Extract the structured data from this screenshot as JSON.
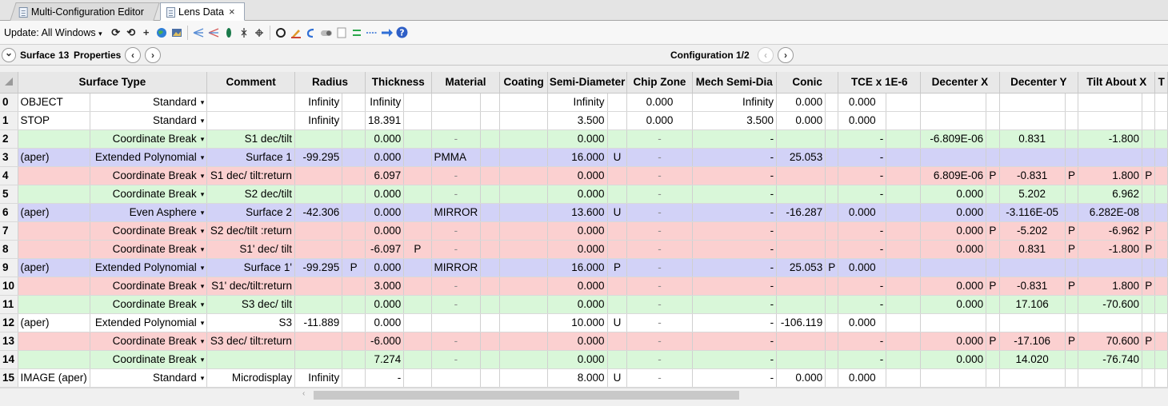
{
  "tabs": [
    {
      "label": "Multi-Configuration Editor",
      "active": false
    },
    {
      "label": "Lens Data",
      "active": true,
      "close": "×"
    }
  ],
  "toolbar": {
    "update_label": "Update: All Windows",
    "update_caret": "▾",
    "icons": [
      "refresh-icon",
      "refresh-all-icon",
      "crosshair-icon",
      "globe-icon",
      "picture-icon",
      "ray-fan-icon",
      "ray-fan-alt-icon",
      "lens-up-icon",
      "lens-down-icon",
      "lens-split-icon",
      "aperture-icon",
      "edit-pen-icon",
      "undo-icon",
      "toggle-icon",
      "document-icon",
      "arrows-icon",
      "link-icon",
      "arrow-right-icon",
      "help-icon"
    ]
  },
  "propbar": {
    "expand_glyph": "⌄",
    "surface_label": "Surface",
    "surface_number": "13",
    "properties_label": "Properties",
    "prev_glyph": "‹",
    "next_glyph": "›",
    "config_label": "Configuration 1/2"
  },
  "columns": [
    "",
    "Surface Type",
    "Comment",
    "Radius",
    "Thickness",
    "Material",
    "Coating",
    "Semi-Diameter",
    "Chip Zone",
    "Mech Semi-Dia",
    "Conic",
    "TCE x 1E-6",
    "Decenter X",
    "Decenter Y",
    "Tilt About X",
    "T"
  ],
  "rows": [
    {
      "num": "0",
      "name": "OBJECT",
      "type": "Standard",
      "comment": "",
      "radius": "Infinity",
      "radius_s": "",
      "thickness": "Infinity",
      "thickness_s": "",
      "material": "",
      "coating": "",
      "semi": "Infinity",
      "semi_s": "",
      "chip": "0.000",
      "mech": "Infinity",
      "conic": "0.000",
      "conic_s": "",
      "tce": "0.000",
      "decx": "",
      "decx_s": "",
      "decy": "",
      "decy_s": "",
      "tilt": "",
      "tilt_s": "",
      "color": "white"
    },
    {
      "num": "1",
      "name": "STOP",
      "type": "Standard",
      "comment": "",
      "radius": "Infinity",
      "radius_s": "",
      "thickness": "18.391",
      "thickness_s": "",
      "material": "",
      "coating": "",
      "semi": "3.500",
      "semi_s": "",
      "chip": "0.000",
      "mech": "3.500",
      "conic": "0.000",
      "conic_s": "",
      "tce": "0.000",
      "decx": "",
      "decx_s": "",
      "decy": "",
      "decy_s": "",
      "tilt": "",
      "tilt_s": "",
      "color": "white"
    },
    {
      "num": "2",
      "name": "",
      "type": "Coordinate Break",
      "comment": "S1 dec/tilt",
      "radius": "",
      "radius_s": "",
      "thickness": "0.000",
      "thickness_s": "",
      "material": "-",
      "coating": "",
      "semi": "0.000",
      "semi_s": "",
      "chip": "-",
      "mech": "-",
      "conic": "",
      "conic_s": "",
      "tce": "-",
      "decx": "-6.809E-06",
      "decx_s": "",
      "decy": "0.831",
      "decy_s": "",
      "tilt": "-1.800",
      "tilt_s": "",
      "color": "green"
    },
    {
      "num": "3",
      "name": "(aper)",
      "type": "Extended Polynomial",
      "comment": "Surface 1",
      "radius": "-99.295",
      "radius_s": "",
      "thickness": "0.000",
      "thickness_s": "",
      "material": "PMMA",
      "coating": "",
      "semi": "16.000",
      "semi_s": "U",
      "chip": "-",
      "mech": "-",
      "conic": "25.053",
      "conic_s": "",
      "tce": "-",
      "decx": "",
      "decx_s": "",
      "decy": "",
      "decy_s": "",
      "tilt": "",
      "tilt_s": "",
      "color": "blue"
    },
    {
      "num": "4",
      "name": "",
      "type": "Coordinate Break",
      "comment": "S1 dec/ tilt:return",
      "radius": "",
      "radius_s": "",
      "thickness": "6.097",
      "thickness_s": "",
      "material": "-",
      "coating": "",
      "semi": "0.000",
      "semi_s": "",
      "chip": "-",
      "mech": "-",
      "conic": "",
      "conic_s": "",
      "tce": "-",
      "decx": "6.809E-06",
      "decx_s": "P",
      "decy": "-0.831",
      "decy_s": "P",
      "tilt": "1.800",
      "tilt_s": "P",
      "color": "pink"
    },
    {
      "num": "5",
      "name": "",
      "type": "Coordinate Break",
      "comment": "S2 dec/tilt",
      "radius": "",
      "radius_s": "",
      "thickness": "0.000",
      "thickness_s": "",
      "material": "-",
      "coating": "",
      "semi": "0.000",
      "semi_s": "",
      "chip": "-",
      "mech": "-",
      "conic": "",
      "conic_s": "",
      "tce": "-",
      "decx": "0.000",
      "decx_s": "",
      "decy": "5.202",
      "decy_s": "",
      "tilt": "6.962",
      "tilt_s": "",
      "color": "green"
    },
    {
      "num": "6",
      "name": "(aper)",
      "type": "Even Asphere",
      "comment": "Surface 2",
      "radius": "-42.306",
      "radius_s": "",
      "thickness": "0.000",
      "thickness_s": "",
      "material": "MIRROR",
      "coating": "",
      "semi": "13.600",
      "semi_s": "U",
      "chip": "-",
      "mech": "-",
      "conic": "-16.287",
      "conic_s": "",
      "tce": "0.000",
      "decx": "0.000",
      "decx_s": "",
      "decy": "-3.116E-05",
      "decy_s": "",
      "tilt": "6.282E-08",
      "tilt_s": "",
      "color": "blue"
    },
    {
      "num": "7",
      "name": "",
      "type": "Coordinate Break",
      "comment": "S2 dec/tilt :return",
      "radius": "",
      "radius_s": "",
      "thickness": "0.000",
      "thickness_s": "",
      "material": "-",
      "coating": "",
      "semi": "0.000",
      "semi_s": "",
      "chip": "-",
      "mech": "-",
      "conic": "",
      "conic_s": "",
      "tce": "-",
      "decx": "0.000",
      "decx_s": "P",
      "decy": "-5.202",
      "decy_s": "P",
      "tilt": "-6.962",
      "tilt_s": "P",
      "color": "pink"
    },
    {
      "num": "8",
      "name": "",
      "type": "Coordinate Break",
      "comment": "S1' dec/ tilt",
      "radius": "",
      "radius_s": "",
      "thickness": "-6.097",
      "thickness_s": "P",
      "material": "-",
      "coating": "",
      "semi": "0.000",
      "semi_s": "",
      "chip": "-",
      "mech": "-",
      "conic": "",
      "conic_s": "",
      "tce": "-",
      "decx": "0.000",
      "decx_s": "",
      "decy": "0.831",
      "decy_s": "P",
      "tilt": "-1.800",
      "tilt_s": "P",
      "color": "pink"
    },
    {
      "num": "9",
      "name": "(aper)",
      "type": "Extended Polynomial",
      "comment": "Surface 1'",
      "radius": "-99.295",
      "radius_s": "P",
      "thickness": "0.000",
      "thickness_s": "",
      "material": "MIRROR",
      "coating": "",
      "semi": "16.000",
      "semi_s": "P",
      "chip": "-",
      "mech": "-",
      "conic": "25.053",
      "conic_s": "P",
      "tce": "0.000",
      "decx": "",
      "decx_s": "",
      "decy": "",
      "decy_s": "",
      "tilt": "",
      "tilt_s": "",
      "color": "blue"
    },
    {
      "num": "10",
      "name": "",
      "type": "Coordinate Break",
      "comment": "S1' dec/tilt:return",
      "radius": "",
      "radius_s": "",
      "thickness": "3.000",
      "thickness_s": "",
      "material": "-",
      "coating": "",
      "semi": "0.000",
      "semi_s": "",
      "chip": "-",
      "mech": "-",
      "conic": "",
      "conic_s": "",
      "tce": "-",
      "decx": "0.000",
      "decx_s": "P",
      "decy": "-0.831",
      "decy_s": "P",
      "tilt": "1.800",
      "tilt_s": "P",
      "color": "pink"
    },
    {
      "num": "11",
      "name": "",
      "type": "Coordinate Break",
      "comment": "S3 dec/ tilt",
      "radius": "",
      "radius_s": "",
      "thickness": "0.000",
      "thickness_s": "",
      "material": "-",
      "coating": "",
      "semi": "0.000",
      "semi_s": "",
      "chip": "-",
      "mech": "-",
      "conic": "",
      "conic_s": "",
      "tce": "-",
      "decx": "0.000",
      "decx_s": "",
      "decy": "17.106",
      "decy_s": "",
      "tilt": "-70.600",
      "tilt_s": "",
      "color": "green"
    },
    {
      "num": "12",
      "name": "(aper)",
      "type": "Extended Polynomial",
      "comment": "S3",
      "radius": "-11.889",
      "radius_s": "",
      "thickness": "0.000",
      "thickness_s": "",
      "material": "",
      "coating": "",
      "semi": "10.000",
      "semi_s": "U",
      "chip": "-",
      "mech": "-",
      "conic": "-106.119",
      "conic_s": "",
      "tce": "0.000",
      "decx": "",
      "decx_s": "",
      "decy": "",
      "decy_s": "",
      "tilt": "",
      "tilt_s": "",
      "color": "white"
    },
    {
      "num": "13",
      "name": "",
      "type": "Coordinate Break",
      "comment": "S3 dec/ tilt:return",
      "radius": "",
      "radius_s": "",
      "thickness": "-6.000",
      "thickness_s": "",
      "material": "-",
      "coating": "",
      "semi": "0.000",
      "semi_s": "",
      "chip": "-",
      "mech": "-",
      "conic": "",
      "conic_s": "",
      "tce": "-",
      "decx": "0.000",
      "decx_s": "P",
      "decy": "-17.106",
      "decy_s": "P",
      "tilt": "70.600",
      "tilt_s": "P",
      "color": "pink"
    },
    {
      "num": "14",
      "name": "",
      "type": "Coordinate Break",
      "comment": "",
      "radius": "",
      "radius_s": "",
      "thickness": "7.274",
      "thickness_s": "",
      "material": "-",
      "coating": "",
      "semi": "0.000",
      "semi_s": "",
      "chip": "-",
      "mech": "-",
      "conic": "",
      "conic_s": "",
      "tce": "-",
      "decx": "0.000",
      "decx_s": "",
      "decy": "14.020",
      "decy_s": "",
      "tilt": "-76.740",
      "tilt_s": "",
      "color": "green"
    },
    {
      "num": "15",
      "name": "IMAGE (aper)",
      "type": "Standard",
      "comment": "Microdisplay",
      "radius": "Infinity",
      "radius_s": "",
      "thickness": "-",
      "thickness_s": "",
      "material": "",
      "coating": "",
      "semi": "8.000",
      "semi_s": "U",
      "chip": "-",
      "mech": "-",
      "conic": "0.000",
      "conic_s": "",
      "tce": "0.000",
      "decx": "",
      "decx_s": "",
      "decy": "",
      "decy_s": "",
      "tilt": "",
      "tilt_s": "",
      "color": "white"
    }
  ],
  "type_caret": "▾",
  "scroll_left_glyph": "‹"
}
